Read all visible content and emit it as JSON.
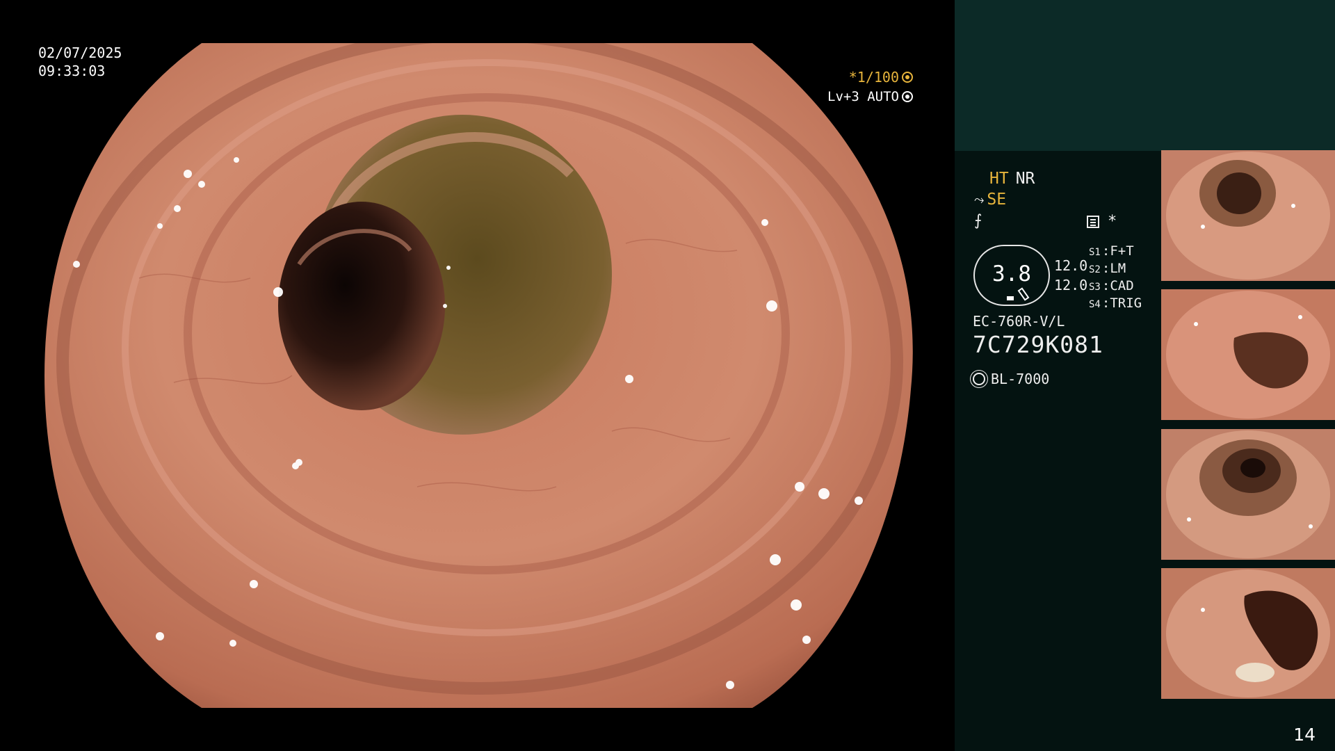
{
  "overlay": {
    "date": "02/07/2025",
    "time": "09:33:03",
    "shutter": "*1/100",
    "shutter_icon": "aperture-icon",
    "level": "Lv+3 AUTO",
    "level_icon": "iris-icon"
  },
  "panel": {
    "ht_label": "HT",
    "nr_label": "NR",
    "se_label": "SE",
    "star": "*",
    "oval_value": "3.8",
    "level_values": [
      "12.0",
      "12.0"
    ],
    "switches": [
      {
        "key": "S1",
        "value": "F+T"
      },
      {
        "key": "S2",
        "value": "LM"
      },
      {
        "key": "S3",
        "value": "CAD"
      },
      {
        "key": "S4",
        "value": "TRIG"
      }
    ],
    "scope_model": "EC-760R-V/L",
    "scope_serial": "7C729K081",
    "light_source": "BL-7000",
    "page_number": "14"
  },
  "colors": {
    "panel_bg": "#041311",
    "panel_top_bg": "#0c2a27",
    "accent_yellow": "#e8b53c",
    "text": "#eeeeee"
  }
}
